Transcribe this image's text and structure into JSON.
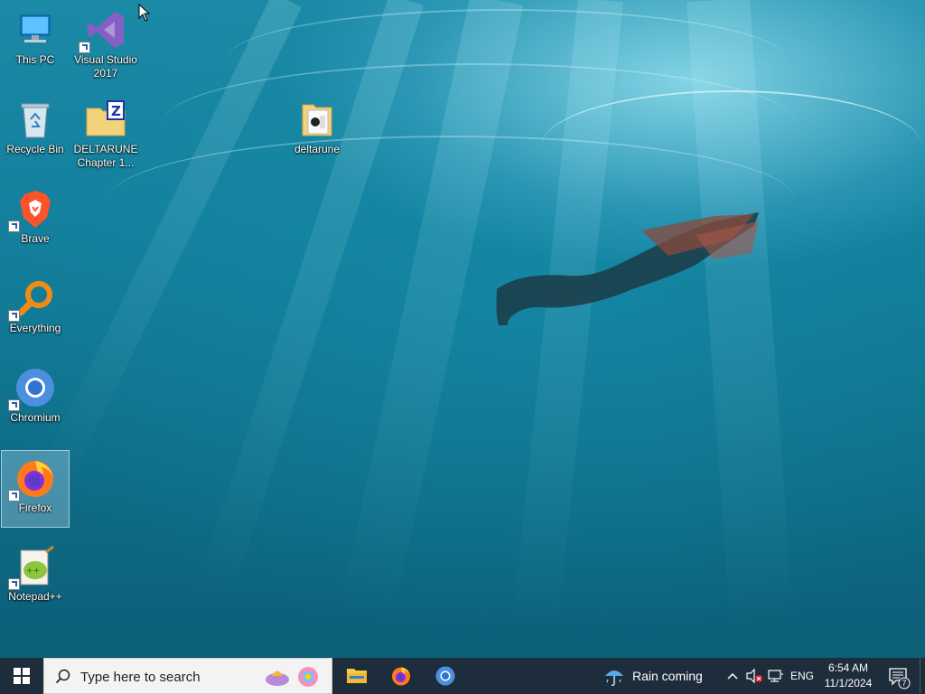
{
  "desktop": {
    "icons": [
      {
        "label": "This PC",
        "icon": "computer-icon",
        "shortcut": false
      },
      {
        "label": "Visual Studio 2017",
        "icon": "visual-studio-icon",
        "shortcut": true
      },
      {
        "label": "Recycle Bin",
        "icon": "recycle-bin-icon",
        "shortcut": false
      },
      {
        "label": "DELTARUNE Chapter 1...",
        "icon": "zip-folder-icon",
        "shortcut": false
      },
      {
        "label": "deltarune",
        "icon": "folder-icon",
        "shortcut": false
      },
      {
        "label": "Brave",
        "icon": "brave-icon",
        "shortcut": true
      },
      {
        "label": "Everything",
        "icon": "everything-search-icon",
        "shortcut": true
      },
      {
        "label": "Chromium",
        "icon": "chromium-icon",
        "shortcut": true
      },
      {
        "label": "Firefox",
        "icon": "firefox-icon",
        "shortcut": true,
        "selected": true
      },
      {
        "label": "Notepad++",
        "icon": "notepad-plus-plus-icon",
        "shortcut": true
      }
    ]
  },
  "taskbar": {
    "search_placeholder": "Type here to search",
    "pinned_apps": [
      "file-explorer-icon",
      "firefox-icon",
      "chromium-icon"
    ],
    "weather_text": "Rain coming",
    "language": "ENG",
    "time": "6:54 AM",
    "date": "11/1/2024",
    "notification_count": "7"
  },
  "colors": {
    "taskbar_bg": "#1e2d3c",
    "search_bg": "#f3f3f3",
    "wallpaper_water": "#137f9c"
  }
}
